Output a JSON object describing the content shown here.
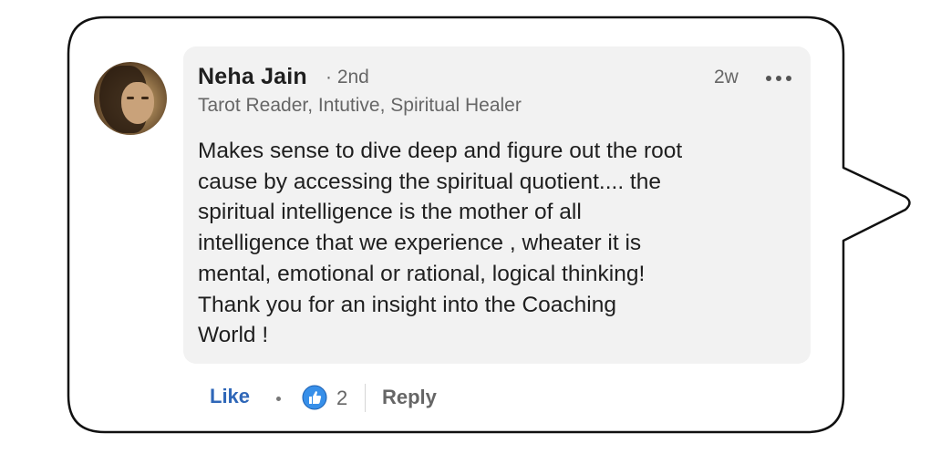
{
  "comment": {
    "author_name": "Neha Jain",
    "connection_degree": "· 2nd",
    "headline": "Tarot Reader, Intutive, Spiritual Healer",
    "timestamp": "2w",
    "body": "Makes sense to dive deep and figure out the root\ncause by accessing the spiritual quotient.... the\nspiritual intelligence is the mother of all\nintelligence that we experience , wheater it is\nmental, emotional or rational, logical thinking!\nThank you for an insight into the Coaching\nWorld !",
    "more_icon": "more-horizontal-icon",
    "avatar_icon": "profile-photo"
  },
  "actions": {
    "like_label": "Like",
    "reaction_icon": "thumbs-up-icon",
    "reaction_count": "2",
    "reply_label": "Reply"
  },
  "colors": {
    "like_blue": "#2f67b8",
    "reaction_blue": "#378fe9",
    "comment_background": "#f2f2f2"
  }
}
